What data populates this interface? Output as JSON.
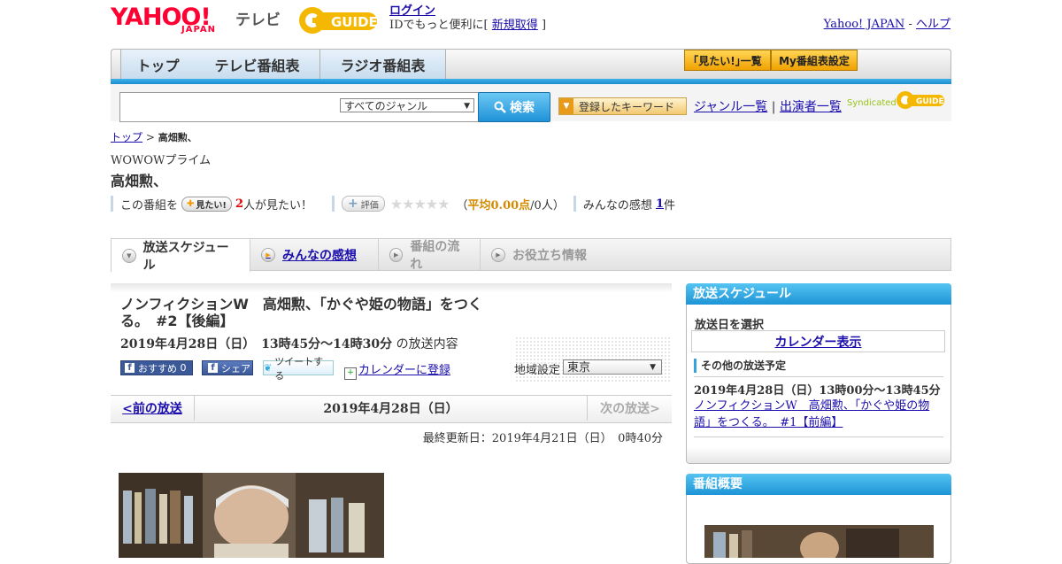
{
  "header": {
    "yahoo_logo": "YAHOO!",
    "japan_logo": "JAPAN",
    "tv_label": "テレビ",
    "gguide_logo": "GUIDE",
    "login_link": "ログイン",
    "login_text_prefix": "IDでもっと便利に[",
    "signup_link": "新規取得",
    "login_text_suffix": "]",
    "yahoo_japan_link": "Yahoo! JAPAN",
    "separator": "-",
    "help_link": "ヘルプ"
  },
  "nav": {
    "tabs": [
      {
        "label": "トップ"
      },
      {
        "label": "テレビ番組表"
      },
      {
        "label": "ラジオ番組表"
      }
    ],
    "mitai_list": "｢見たい!｣一覧",
    "my_schedule": "My番組表設定"
  },
  "search": {
    "input_value": "",
    "genre_selected": "すべてのジャンル",
    "search_button": "検索",
    "keyword_button": "登録したキーワード",
    "genre_list_link": "ジャンル一覧",
    "link_separator": "|",
    "performers_link": "出演者一覧",
    "syndicated": "Syndicated",
    "gguide_small": "GUIDE"
  },
  "breadcrumb": {
    "top": "トップ",
    "sep": ">",
    "current": "高畑勲、"
  },
  "program": {
    "channel": "WOWOWプライム",
    "title": "高畑勲、",
    "stats": {
      "prefix": "この番組を",
      "mitai_button": "見たい!",
      "mitai_count": "2",
      "mitai_suffix": "人が見たい！",
      "hyoka_button": "評価",
      "stars": "★★★★★",
      "rating_open": "（",
      "rating_avg": "平均0.00点",
      "rating_rest": "/0人）",
      "kanso_label": "みんなの感想",
      "kanso_count": "1",
      "kanso_suffix": "件"
    }
  },
  "tabs": [
    {
      "label": "放送スケジュール",
      "state": "active"
    },
    {
      "label": "みんなの感想",
      "state": "link"
    },
    {
      "label": "番組の流れ",
      "state": "disabled"
    },
    {
      "label": "お役立ち情報",
      "state": "disabled"
    }
  ],
  "episode": {
    "title": "ノンフィクションW　高畑勲、「かぐや姫の物語」をつくる。　#2【後編】",
    "date_time": "2019年4月28日（日）　13時45分～14時30分",
    "date_suffix": "の放送内容",
    "fb_recommend": "おすすめ",
    "fb_count": "0",
    "fb_share": "シェア",
    "tweet": "ツイートする",
    "calendar_register": "カレンダーに登録",
    "region_label": "地域設定",
    "region_selected": "東京"
  },
  "pager": {
    "prev": "<前の放送",
    "date": "2019年4月28日（日）",
    "next": "次の放送>"
  },
  "updated": "最終更新日：2019年4月21日（日）　0時40分",
  "sidebar": {
    "schedule_title": "放送スケジュール",
    "select_date": "放送日を選択",
    "calendar_button": "カレンダー表示",
    "other_schedule": "その他の放送予定",
    "other_date": "2019年4月28日（日）13時00分～13時45分",
    "other_link": "ノンフィクションW　高畑勲、「かぐや姫の物語」をつくる。　#1【前編】",
    "overview_title": "番組概要"
  },
  "colors": {
    "accent_blue": "#1d94d6",
    "yahoo_red": "#ff0033",
    "gguide_yellow": "#f5b800",
    "link": "#1a0dab"
  }
}
